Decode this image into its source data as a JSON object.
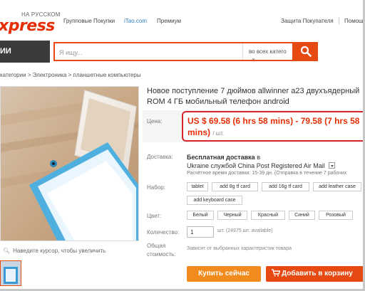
{
  "header": {
    "logo_sub": "НА РУССКОМ",
    "logo": "xpress",
    "links": [
      "Групповые Покупки",
      "iTao.com",
      "Премиум"
    ],
    "right_links": [
      "Защита Покупателя",
      "Помощь"
    ]
  },
  "search": {
    "category_label": "ИИ",
    "placeholder": "Я ищу...",
    "scope": "во всех катего"
  },
  "breadcrumb": "категории > Электроника > планшетные компьютеры",
  "gallery": {
    "zoom_hint": "Наведите курсор, чтобы увеличить"
  },
  "product": {
    "title": "Новое поступление 7 дюймов allwinner a23 двухъядерный ROM 4 ГБ мобильный телефон android",
    "price_label": "Цена:",
    "price": "US $ 69.58 (6 hrs 58 mins) - 79.58 (7 hrs 58 mins)",
    "price_unit": "/ шт."
  },
  "shipping": {
    "label": "Доставка:",
    "free": "Бесплатная доставка",
    "to": "в",
    "method": "Ukraine службой China Post Registered Air Mail",
    "eta": "Расчётное время доставки: 15-39 дн. (Отправка в течение 7 рабочих"
  },
  "bundle": {
    "label": "Набор:",
    "options": [
      "tablet",
      "add 8g tf card",
      "add 16g tf card",
      "add leather case",
      "add keyboard case"
    ]
  },
  "color": {
    "label": "Цвет:",
    "options": [
      "Белый",
      "Черный",
      "Красный",
      "Синий",
      "Розовый"
    ]
  },
  "quantity": {
    "label": "Количество:",
    "value": "1",
    "available": "шт. (24975 шт. available)"
  },
  "total": {
    "label_line1": "Общая",
    "label_line2": "стоимость:",
    "note": "Зависит от выбранных характеристик товара"
  },
  "actions": {
    "buy": "Купить сейчас",
    "add_to_cart": "Добавить в корзину"
  },
  "colors": {
    "accent": "#e64a12",
    "price": "#e62e04",
    "buy": "#f28b1e"
  }
}
